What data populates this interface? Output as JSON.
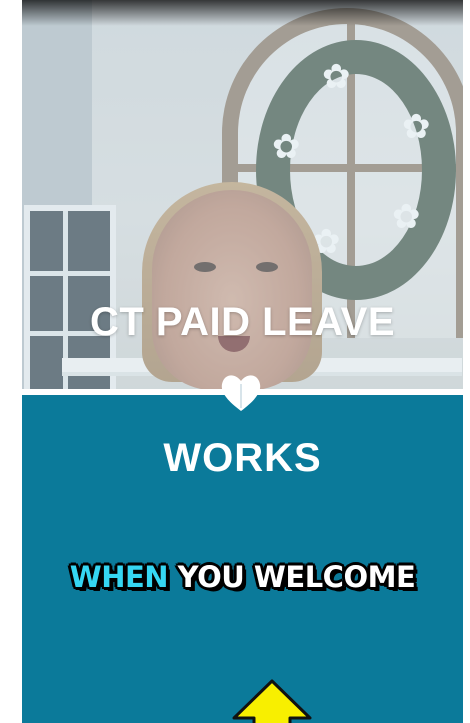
{
  "overlay": {
    "headline_top": "CT PAID LEAVE",
    "headline_bottom": "WORKS",
    "caption_highlight": "WHEN",
    "caption_rest": " YOU WELCOME"
  },
  "colors": {
    "teal_panel": "#0b7a9a",
    "caption_highlight": "#35d6f2",
    "arrow_fill": "#f8ef00"
  },
  "icons": {
    "divider_badge": "heart-icon",
    "pointer": "arrow-up-icon"
  }
}
